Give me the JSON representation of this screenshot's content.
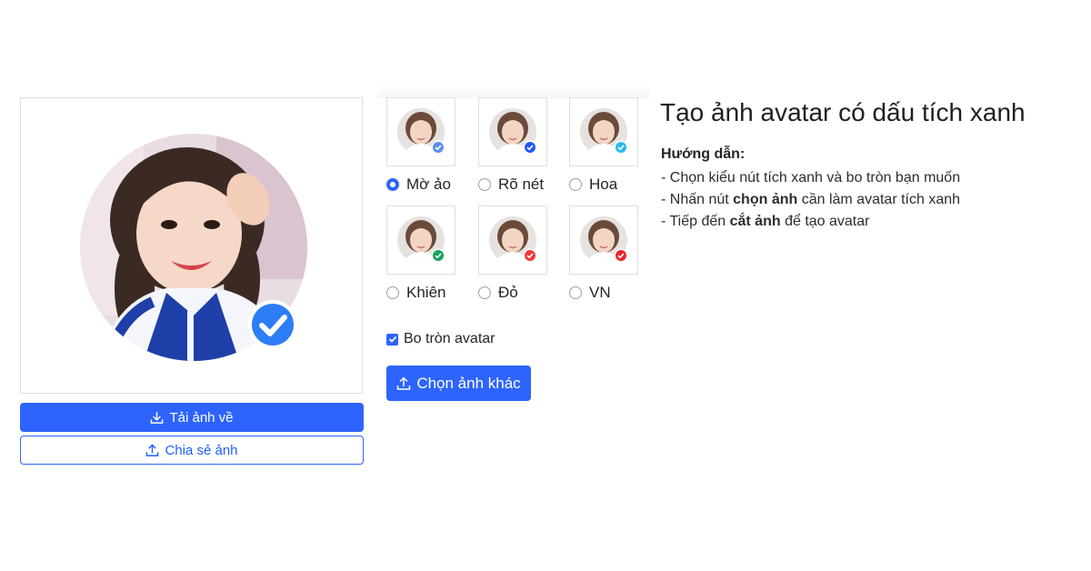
{
  "preview": {
    "download_label": "Tải ảnh về",
    "share_label": "Chia sẻ ảnh"
  },
  "styles": [
    {
      "label": "Mờ ảo",
      "selected": true,
      "badge_color": "#5a8ff5"
    },
    {
      "label": "Rõ nét",
      "selected": false,
      "badge_color": "#2459ff"
    },
    {
      "label": "Hoa",
      "selected": false,
      "badge_color": "#2fb8f0"
    },
    {
      "label": "Khiên",
      "selected": false,
      "badge_color": "#17a35c"
    },
    {
      "label": "Đỏ",
      "selected": false,
      "badge_color": "#f0373c"
    },
    {
      "label": "VN",
      "selected": false,
      "badge_color": "#e8252c"
    }
  ],
  "round_option": {
    "label": "Bo tròn avatar",
    "checked": true
  },
  "choose_button": "Chọn ảnh khác",
  "instructions": {
    "title": "Tạo ảnh avatar có dấu tích xanh",
    "heading": "Hướng dẫn:",
    "line1": "- Chọn kiểu nút tích xanh và bo tròn bạn muốn",
    "line2_pre": "- Nhấn nút ",
    "line2_bold": "chọn ảnh",
    "line2_post": " cần làm avatar tích xanh",
    "line3_pre": "- Tiếp đến ",
    "line3_bold": "cắt ảnh",
    "line3_post": " để tạo avatar"
  },
  "colors": {
    "accent": "#2e64fe",
    "check_blue": "#2d7df6"
  }
}
